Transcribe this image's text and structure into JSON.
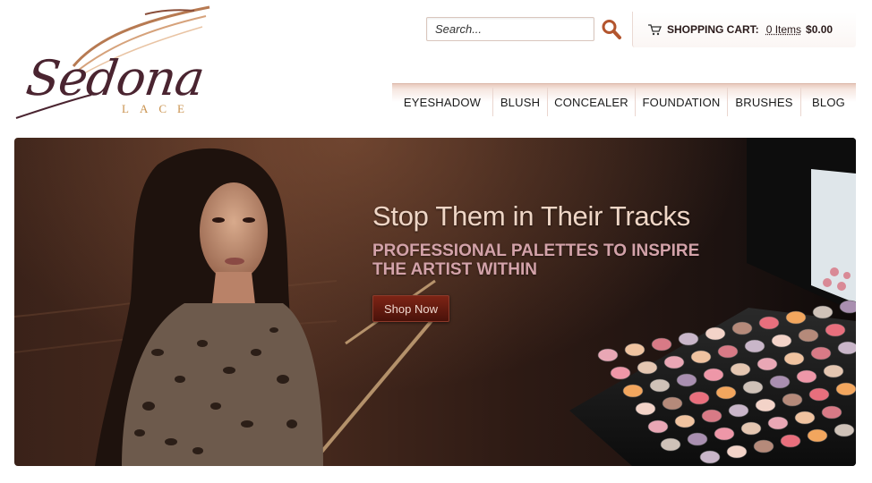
{
  "logo": {
    "word": "Sedona",
    "sub": "LACE"
  },
  "search": {
    "placeholder": "Search...",
    "icon": "search-icon"
  },
  "cart": {
    "icon": "cart-icon",
    "label": "SHOPPING CART:",
    "items": "0 Items",
    "total": "$0.00"
  },
  "nav": {
    "items": [
      {
        "label": "EYESHADOW"
      },
      {
        "label": "BLUSH"
      },
      {
        "label": "CONCEALER"
      },
      {
        "label": "FOUNDATION"
      },
      {
        "label": "BRUSHES"
      },
      {
        "label": "BLOG"
      }
    ]
  },
  "hero": {
    "title": "Stop Them in Their Tracks",
    "subtitle_line1": "PROFESSIONAL PALETTES TO INSPIRE",
    "subtitle_line2": "THE ARTIST WITHIN",
    "button": "Shop Now"
  },
  "colors": {
    "brand_dark": "#4a2430",
    "brand_gold": "#c9924e",
    "button_bg": "#6a1b10",
    "title_text": "#efd6c6",
    "subtitle_text": "#d3a2a9"
  }
}
